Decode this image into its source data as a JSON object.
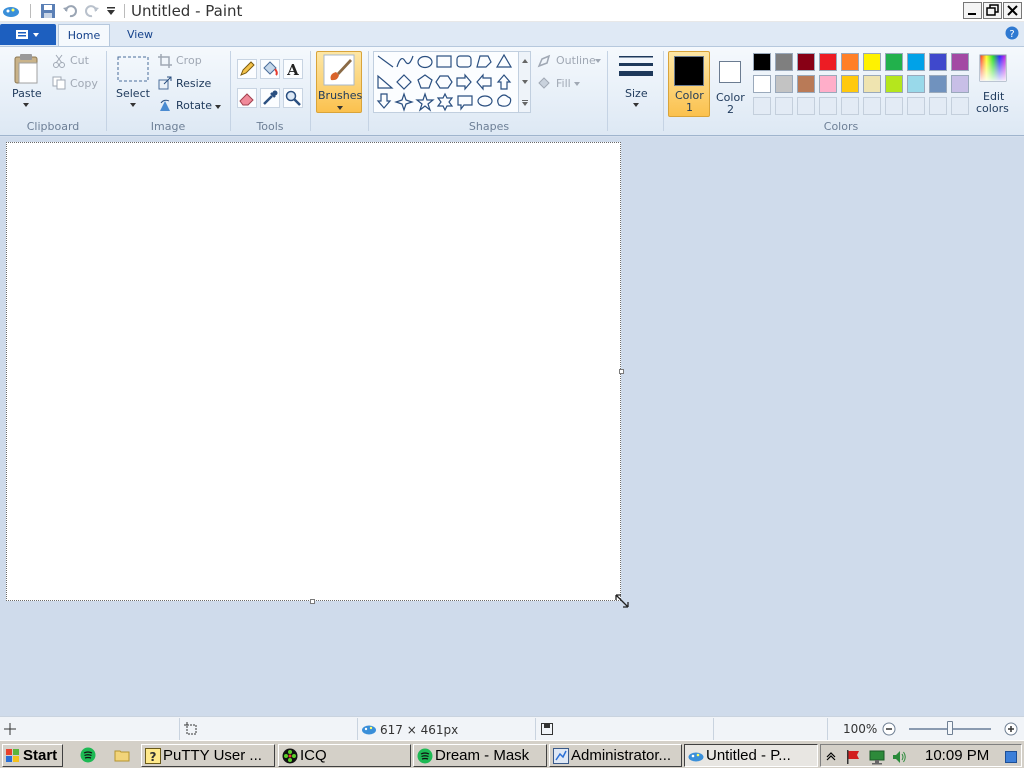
{
  "window": {
    "title": "Untitled - Paint"
  },
  "tabs": [
    {
      "label": "Home"
    },
    {
      "label": "View"
    }
  ],
  "clipboard": {
    "paste": "Paste",
    "cut": "Cut",
    "copy": "Copy",
    "label": "Clipboard"
  },
  "image": {
    "select": "Select",
    "crop": "Crop",
    "resize": "Resize",
    "rotate": "Rotate",
    "label": "Image"
  },
  "tools": {
    "label": "Tools"
  },
  "brushes": {
    "label": "Brushes"
  },
  "shapes": {
    "outline": "Outline",
    "fill": "Fill",
    "label": "Shapes"
  },
  "size": {
    "label": "Size"
  },
  "colors": {
    "color1": "Color\n1",
    "color1_line1": "Color",
    "color1_line2": "1",
    "color2_line1": "Color",
    "color2_line2": "2",
    "edit_line1": "Edit",
    "edit_line2": "colors",
    "label": "Colors",
    "row1": [
      "#000000",
      "#7f7f7f",
      "#880015",
      "#ed1c24",
      "#ff7f27",
      "#fff200",
      "#22b14c",
      "#00a2e8",
      "#3f48cc",
      "#a349a4"
    ],
    "row2": [
      "#ffffff",
      "#c3c3c3",
      "#b97a57",
      "#ffaec9",
      "#ffc90e",
      "#efe4b0",
      "#b5e61d",
      "#99d9ea",
      "#7092be",
      "#c8bfe7"
    ],
    "color1_value": "#000000",
    "color2_value": "#ffffff"
  },
  "status": {
    "dimensions": "617 × 461px",
    "zoom": "100%",
    "zoom_level": 0.5
  },
  "taskbar": {
    "start": "Start",
    "tasks": [
      {
        "label": "PuTTY User ..."
      },
      {
        "label": "ICQ"
      },
      {
        "label": "Dream - Mask"
      },
      {
        "label": "Administrator..."
      },
      {
        "label": "Untitled - P..."
      }
    ],
    "clock": "10:09 PM"
  }
}
